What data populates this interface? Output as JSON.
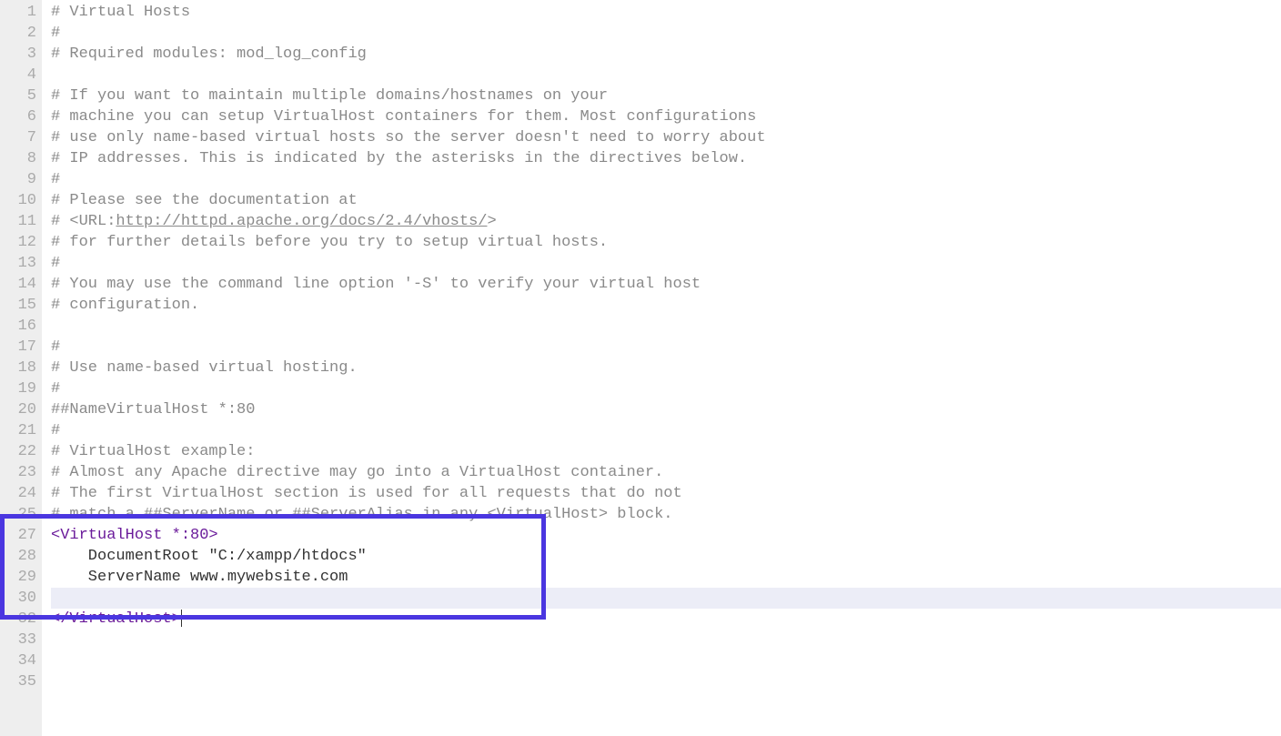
{
  "lines": [
    {
      "n": 1,
      "segs": [
        {
          "cls": "comment",
          "t": "# Virtual Hosts"
        }
      ]
    },
    {
      "n": 2,
      "segs": [
        {
          "cls": "comment",
          "t": "#"
        }
      ]
    },
    {
      "n": 3,
      "segs": [
        {
          "cls": "comment",
          "t": "# Required modules: mod_log_config"
        }
      ]
    },
    {
      "n": 4,
      "segs": [
        {
          "cls": "",
          "t": ""
        }
      ]
    },
    {
      "n": 5,
      "segs": [
        {
          "cls": "comment",
          "t": "# If you want to maintain multiple domains/hostnames on your"
        }
      ]
    },
    {
      "n": 6,
      "segs": [
        {
          "cls": "comment",
          "t": "# machine you can setup VirtualHost containers for them. Most configurations"
        }
      ]
    },
    {
      "n": 7,
      "segs": [
        {
          "cls": "comment",
          "t": "# use only name-based virtual hosts so the server doesn't need to worry about"
        }
      ]
    },
    {
      "n": 8,
      "segs": [
        {
          "cls": "comment",
          "t": "# IP addresses. This is indicated by the asterisks in the directives below."
        }
      ]
    },
    {
      "n": 9,
      "segs": [
        {
          "cls": "comment",
          "t": "#"
        }
      ]
    },
    {
      "n": 10,
      "segs": [
        {
          "cls": "comment",
          "t": "# Please see the documentation at"
        }
      ]
    },
    {
      "n": 11,
      "segs": [
        {
          "cls": "comment",
          "t": "# <URL:"
        },
        {
          "cls": "link",
          "t": "http://httpd.apache.org/docs/2.4/vhosts/"
        },
        {
          "cls": "comment",
          "t": ">"
        }
      ]
    },
    {
      "n": 12,
      "segs": [
        {
          "cls": "comment",
          "t": "# for further details before you try to setup virtual hosts."
        }
      ]
    },
    {
      "n": 13,
      "segs": [
        {
          "cls": "comment",
          "t": "#"
        }
      ]
    },
    {
      "n": 14,
      "segs": [
        {
          "cls": "comment",
          "t": "# You may use the command line option '-S' to verify your virtual host"
        }
      ]
    },
    {
      "n": 15,
      "segs": [
        {
          "cls": "comment",
          "t": "# configuration."
        }
      ]
    },
    {
      "n": 16,
      "segs": [
        {
          "cls": "",
          "t": ""
        }
      ]
    },
    {
      "n": 17,
      "segs": [
        {
          "cls": "comment",
          "t": "#"
        }
      ]
    },
    {
      "n": 18,
      "segs": [
        {
          "cls": "comment",
          "t": "# Use name-based virtual hosting."
        }
      ]
    },
    {
      "n": 19,
      "segs": [
        {
          "cls": "comment",
          "t": "#"
        }
      ]
    },
    {
      "n": 20,
      "segs": [
        {
          "cls": "comment",
          "t": "##NameVirtualHost *:80"
        }
      ]
    },
    {
      "n": 21,
      "segs": [
        {
          "cls": "comment",
          "t": "#"
        }
      ]
    },
    {
      "n": 22,
      "segs": [
        {
          "cls": "comment",
          "t": "# VirtualHost example:"
        }
      ]
    },
    {
      "n": 23,
      "segs": [
        {
          "cls": "comment",
          "t": "# Almost any Apache directive may go into a VirtualHost container."
        }
      ]
    },
    {
      "n": 24,
      "segs": [
        {
          "cls": "comment",
          "t": "# The first VirtualHost section is used for all requests that do not"
        }
      ]
    },
    {
      "n": 25,
      "segs": [
        {
          "cls": "comment",
          "t": "# match a ##ServerName or ##ServerAlias in any <VirtualHost> block."
        }
      ]
    },
    {
      "n": 27,
      "segs": [
        {
          "cls": "tag",
          "t": "<VirtualHost *:80>"
        }
      ]
    },
    {
      "n": 28,
      "segs": [
        {
          "cls": "attr",
          "t": "    DocumentRoot "
        },
        {
          "cls": "string",
          "t": "\"C:/xampp/htdocs\""
        }
      ]
    },
    {
      "n": 29,
      "segs": [
        {
          "cls": "attr",
          "t": "    ServerName www.mywebsite.com"
        }
      ]
    },
    {
      "n": 30,
      "segs": [
        {
          "cls": "tag",
          "t": "</VirtualHost>"
        }
      ],
      "current": true,
      "caret": true
    },
    {
      "n": 32,
      "segs": [
        {
          "cls": "",
          "t": ""
        }
      ]
    },
    {
      "n": 33,
      "segs": [
        {
          "cls": "",
          "t": ""
        }
      ]
    },
    {
      "n": 34,
      "segs": [
        {
          "cls": "",
          "t": ""
        }
      ]
    },
    {
      "n": 35,
      "segs": [
        {
          "cls": "",
          "t": ""
        }
      ]
    }
  ],
  "highlight": {
    "startLine": 27,
    "endLine": 30
  }
}
